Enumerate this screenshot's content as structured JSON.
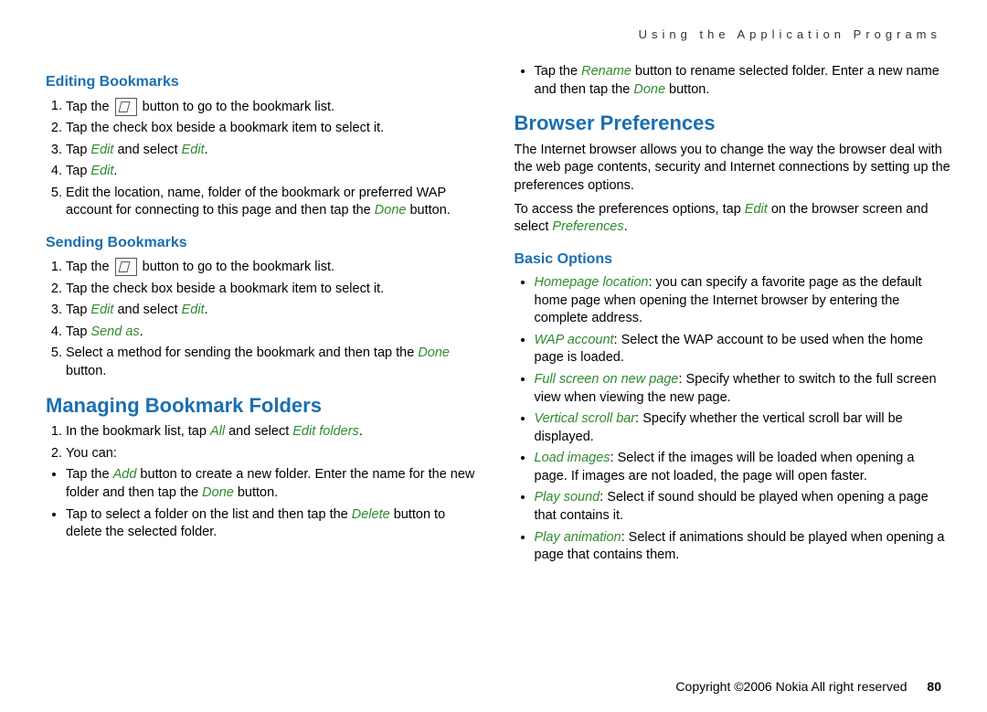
{
  "header": "Using the Application Programs",
  "left": {
    "h3_edit": "Editing Bookmarks",
    "edit_steps": {
      "s1a": "Tap the ",
      "s1b": " button to go to the bookmark list.",
      "s2": "Tap the check box beside a bookmark item to select it.",
      "s3a": "Tap ",
      "s3b": "Edit",
      "s3c": " and select ",
      "s3d": "Edit",
      "s3e": ".",
      "s4a": "Tap ",
      "s4b": "Edit",
      "s4c": ".",
      "s5a": "Edit the location, name, folder of the bookmark or preferred WAP account for connecting to this page and then tap the ",
      "s5b": "Done",
      "s5c": " button."
    },
    "h3_send": "Sending Bookmarks",
    "send_steps": {
      "s1a": "Tap the ",
      "s1b": " button to go to the bookmark list.",
      "s2": "Tap the check box beside a bookmark item to select it.",
      "s3a": "Tap ",
      "s3b": "Edit",
      "s3c": " and select ",
      "s3d": "Edit",
      "s3e": ".",
      "s4a": "Tap ",
      "s4b": "Send as",
      "s4c": ".",
      "s5a": "Select a method for sending the bookmark and then tap the ",
      "s5b": "Done",
      "s5c": " button."
    },
    "h2_manage": "Managing Bookmark Folders",
    "manage_steps": {
      "s1a": "In the bookmark list, tap ",
      "s1b": "All",
      "s1c": " and select ",
      "s1d": "Edit folders",
      "s1e": ".",
      "s2": "You can:"
    },
    "manage_bullets": {
      "b1a": "Tap the ",
      "b1b": "Add",
      "b1c": " button to create a new folder. Enter the name for the new folder and then tap the ",
      "b1d": "Done",
      "b1e": " button.",
      "b2a": " Tap to select a folder on the list and then tap the ",
      "b2b": "Delete",
      "b2c": " button to delete the selected folder."
    }
  },
  "right": {
    "top_bullet": {
      "a": "Tap the ",
      "b": "Rename",
      "c": " button to rename selected folder. Enter a new name and then tap the ",
      "d": "Done",
      "e": " button."
    },
    "h2_pref": "Browser Preferences",
    "pref_p1": "The Internet browser allows you to change the way the browser deal with the web page contents, security and Internet connections by setting up the preferences options.",
    "pref_p2a": "To access the preferences options, tap ",
    "pref_p2b": "Edit",
    "pref_p2c": " on the browser screen and select ",
    "pref_p2d": "Preferences",
    "pref_p2e": ".",
    "h3_basic": "Basic Options",
    "basic": {
      "b1a": "Homepage location",
      "b1b": ": you can specify a favorite page as the default home page when opening the Internet browser by entering the complete address.",
      "b2a": "WAP account",
      "b2b": ": Select the WAP account to be used when the home page is loaded.",
      "b3a": "Full screen on new page",
      "b3b": ": Specify whether to switch to the full screen view when viewing the new page.",
      "b4a": "Vertical scroll bar",
      "b4b": ": Specify whether the vertical scroll bar will be displayed.",
      "b5a": "Load images",
      "b5b": ": Select if the images will be loaded when opening a page. If images are not loaded, the page will open faster.",
      "b6a": "Play sound",
      "b6b": ": Select if sound should be played when opening a page that contains it.",
      "b7a": "Play animation",
      "b7b": ": Select if animations should be played when opening a page that contains them."
    }
  },
  "footer": {
    "copyright": "Copyright ©2006 Nokia All right reserved",
    "page": "80"
  }
}
